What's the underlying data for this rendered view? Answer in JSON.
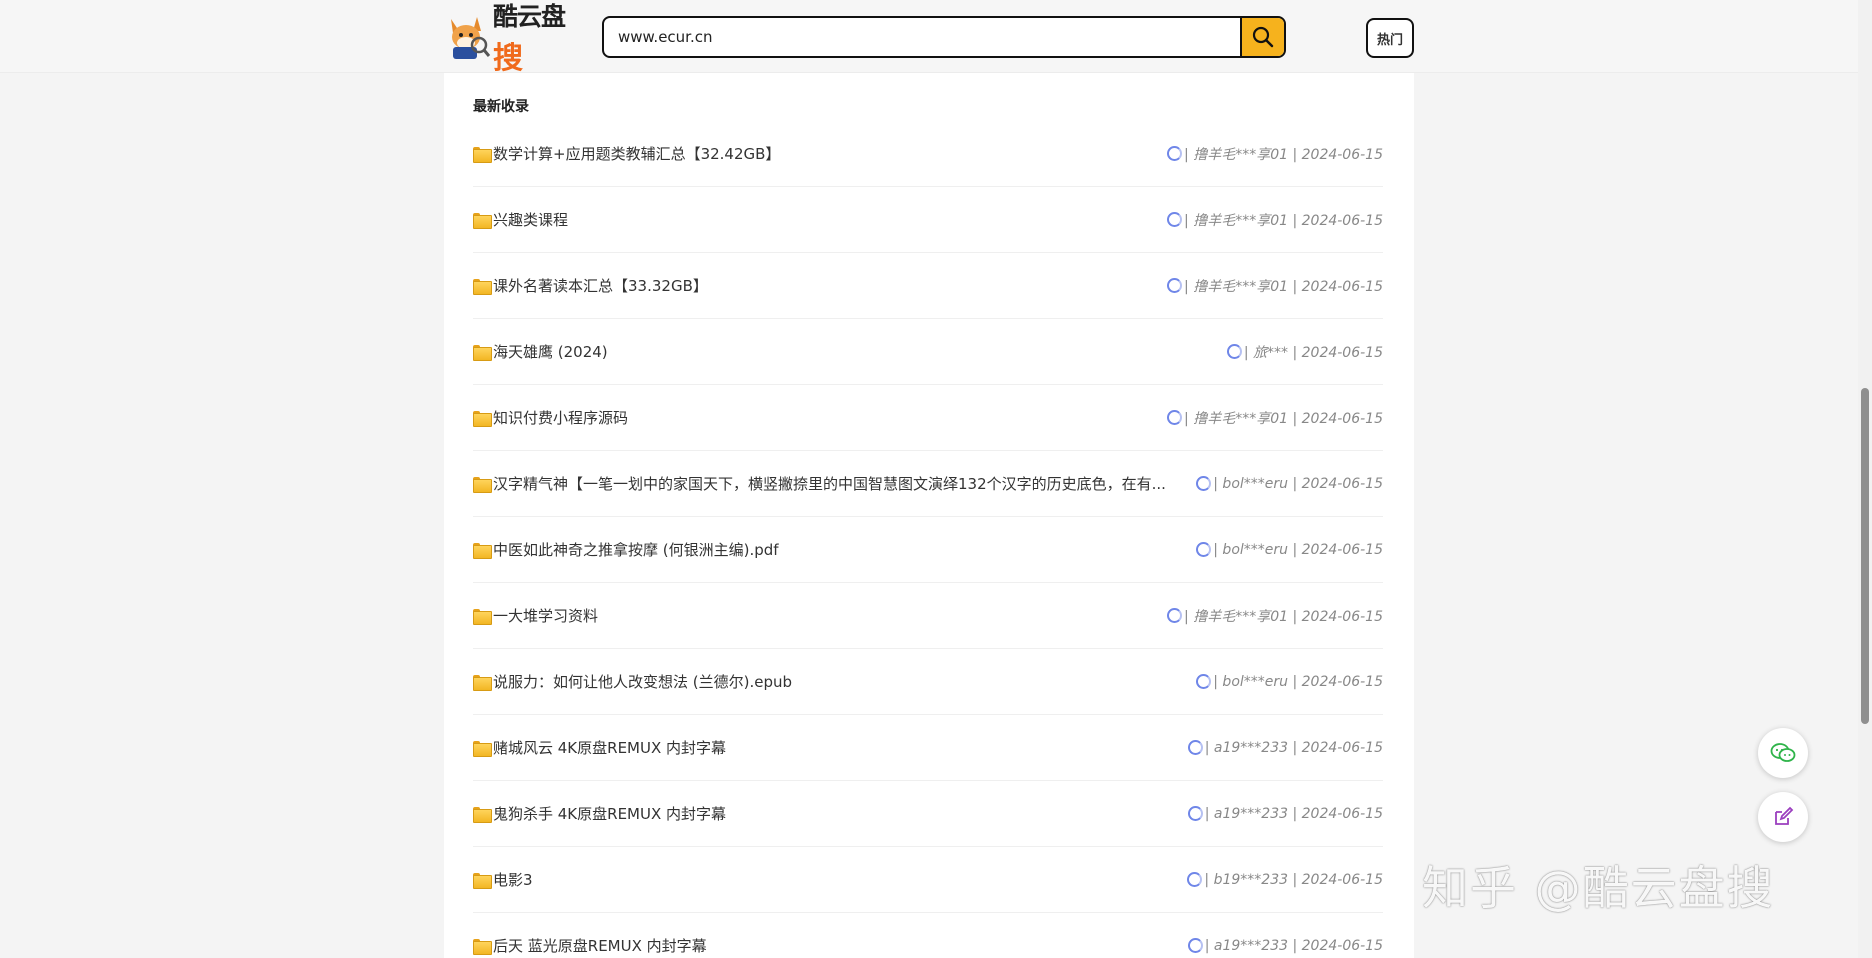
{
  "header": {
    "logo_text_main": "酷云盘",
    "logo_text_accent": "搜",
    "search_value": "www.ecur.cn",
    "hot_label": "热门"
  },
  "section": {
    "title": "最新收录"
  },
  "items": [
    {
      "title": "数学计算+应用题类教辅汇总【32.42GB】",
      "meta": "| 撸羊毛***享01 | 2024-06-15"
    },
    {
      "title": "兴趣类课程",
      "meta": "| 撸羊毛***享01 | 2024-06-15"
    },
    {
      "title": "课外名著读本汇总【33.32GB】",
      "meta": "| 撸羊毛***享01 | 2024-06-15"
    },
    {
      "title": "海天雄鹰 (2024)",
      "meta": "| 旅*** | 2024-06-15"
    },
    {
      "title": "知识付费小程序源码",
      "meta": "| 撸羊毛***享01 | 2024-06-15"
    },
    {
      "title": "汉字精气神【一笔一划中的家国天下，横竖撇捺里的中国智慧图文演绎132个汉字的历史底色，在有...",
      "meta": "| bol***eru | 2024-06-15"
    },
    {
      "title": "中医如此神奇之推拿按摩 (何银洲主编).pdf",
      "meta": "| bol***eru | 2024-06-15"
    },
    {
      "title": "一大堆学习资料",
      "meta": "| 撸羊毛***享01 | 2024-06-15"
    },
    {
      "title": "说服力：如何让他人改变想法 (兰德尔).epub",
      "meta": "| bol***eru | 2024-06-15"
    },
    {
      "title": "赌城风云 4K原盘REMUX 内封字幕",
      "meta": "| a19***233 | 2024-06-15"
    },
    {
      "title": "鬼狗杀手 4K原盘REMUX 内封字幕",
      "meta": "| a19***233 | 2024-06-15"
    },
    {
      "title": "电影3",
      "meta": "| b19***233 | 2024-06-15"
    },
    {
      "title": "后天 蓝光原盘REMUX 内封字幕",
      "meta": "| a19***233 | 2024-06-15"
    }
  ],
  "watermark": "知乎 @酷云盘搜",
  "colors": {
    "accent": "#f6b21d",
    "logo_accent": "#f06a1c",
    "cloud": "#6f86e8"
  }
}
